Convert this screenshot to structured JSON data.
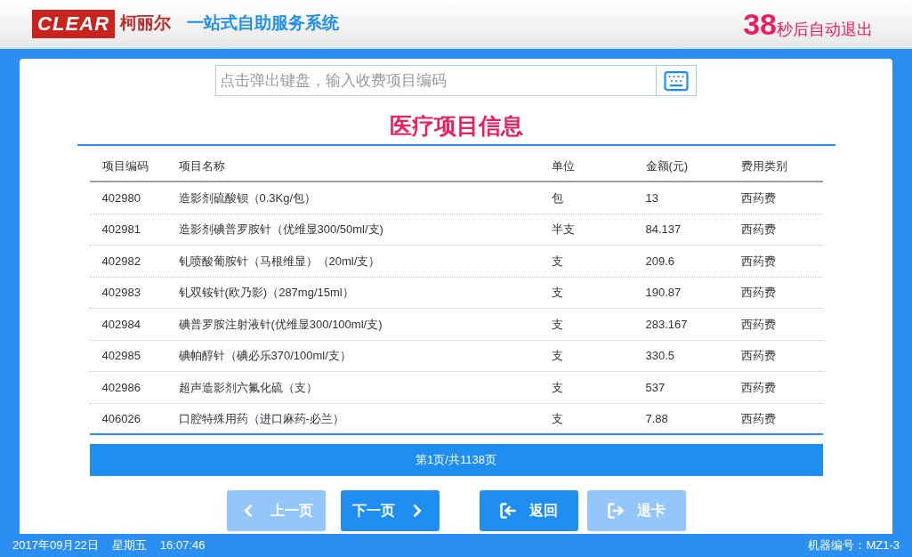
{
  "header": {
    "logo_mark": "CLEAR",
    "logo_name": "柯丽尔",
    "system_title": "一站式自助服务系统",
    "countdown": {
      "seconds": "38",
      "label": "秒后自动退出"
    }
  },
  "search": {
    "placeholder": "点击弹出键盘，输入收费项目编码"
  },
  "title": "医疗项目信息",
  "table": {
    "columns": [
      "项目编码",
      "项目名称",
      "单位",
      "金额(元)",
      "费用类别"
    ],
    "rows": [
      [
        "402980",
        "造影剂硫酸钡（0.3Kg/包）",
        "包",
        "13",
        "西药费"
      ],
      [
        "402981",
        "造影剂碘普罗胺针（优维显300/50ml/支)",
        "半支",
        "84.137",
        "西药费"
      ],
      [
        "402982",
        "钆喷酸葡胺针（马根维显）（20ml/支）",
        "支",
        "209.6",
        "西药费"
      ],
      [
        "402983",
        "钆双铵针(欧乃影)（287mg/15ml）",
        "支",
        "190.87",
        "西药费"
      ],
      [
        "402984",
        "碘普罗胺注射液针(优维显300/100ml/支)",
        "支",
        "283.167",
        "西药费"
      ],
      [
        "402985",
        "碘帕醇针（碘必乐370/100ml/支）",
        "支",
        "330.5",
        "西药费"
      ],
      [
        "402986",
        "超声造影剂六氟化硫（支）",
        "支",
        "537",
        "西药费"
      ],
      [
        "406026",
        "口腔特殊用药（进口麻药-必兰）",
        "支",
        "7.88",
        "西药费"
      ]
    ]
  },
  "pagination": "第1页/共1138页",
  "buttons": [
    {
      "kind": "prev",
      "label": "上一页",
      "disabled": true
    },
    {
      "kind": "next",
      "label": "下一页",
      "disabled": false
    },
    {
      "kind": "back",
      "label": "返回",
      "disabled": false
    },
    {
      "kind": "eject",
      "label": "退卡",
      "disabled": true
    }
  ],
  "status_bar": {
    "date": "2017年09月22日",
    "weekday": "星期五",
    "time": "16:07:46",
    "machine": "机器编号：MZ1-3"
  }
}
